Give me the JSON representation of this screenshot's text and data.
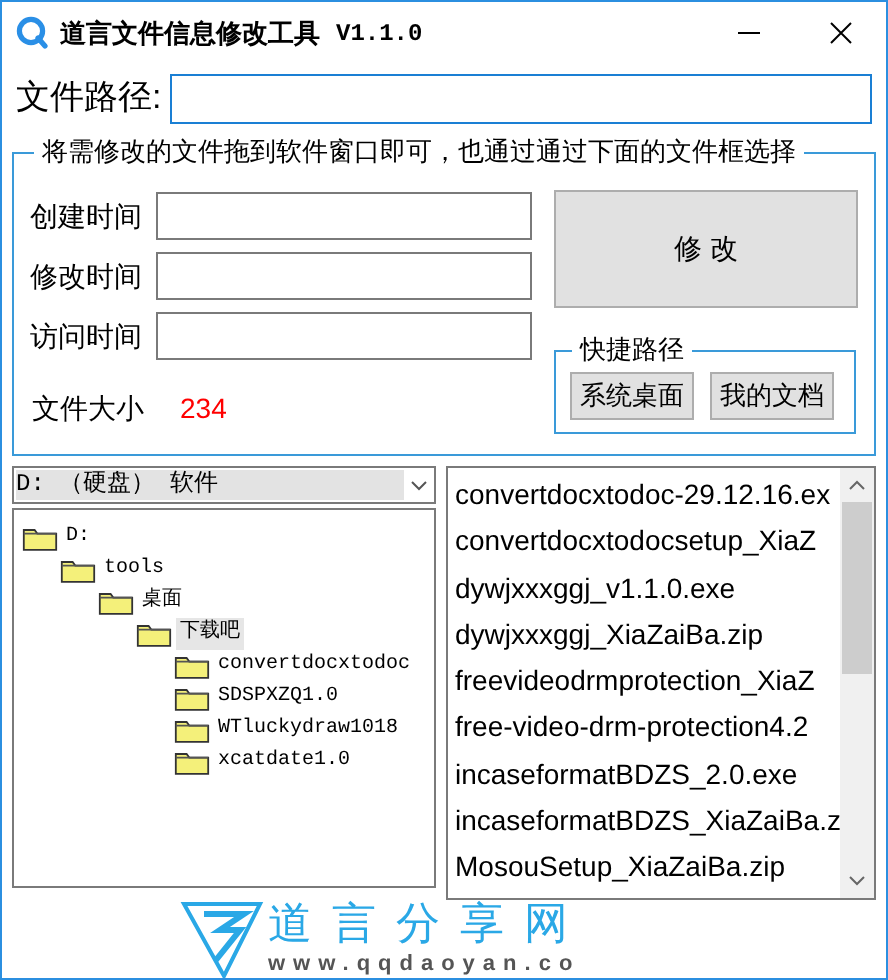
{
  "window": {
    "title": "道言文件信息修改工具",
    "version": "V1.1.0"
  },
  "path_field": {
    "label": "文件路径:"
  },
  "group": {
    "legend": "将需修改的文件拖到软件窗口即可，也通过通过下面的文件框选择",
    "fields": [
      {
        "label": "创建时间"
      },
      {
        "label": "修改时间"
      },
      {
        "label": "访问时间"
      }
    ],
    "size_label": "文件大小",
    "size_value": "234",
    "modify_button": "修 改",
    "shortcuts": {
      "legend": "快捷路径",
      "buttons": [
        "系统桌面",
        "我的文档"
      ]
    }
  },
  "drive_select": {
    "value": "D: （硬盘） 软件"
  },
  "tree": [
    {
      "label": "D:",
      "selected": false,
      "children": [
        {
          "label": "tools",
          "selected": false,
          "children": [
            {
              "label": "桌面",
              "selected": false,
              "children": [
                {
                  "label": "下载吧",
                  "selected": true,
                  "children": [
                    {
                      "label": "convertdocxtodoc",
                      "selected": false
                    },
                    {
                      "label": "SDSPXZQ1.0",
                      "selected": false
                    },
                    {
                      "label": "WTluckydraw1018",
                      "selected": false
                    },
                    {
                      "label": "xcatdate1.0",
                      "selected": false
                    }
                  ]
                }
              ]
            }
          ]
        }
      ]
    }
  ],
  "files": [
    {
      "name": "convertdocxtodoc-29.12.16.ex",
      "selected": false
    },
    {
      "name": "convertdocxtodocsetup_XiaZ",
      "selected": false
    },
    {
      "name": "dywjxxxggj_v1.1.0.exe",
      "selected": false
    },
    {
      "name": "dywjxxxggj_XiaZaiBa.zip",
      "selected": false
    },
    {
      "name": "freevideodrmprotection_XiaZ",
      "selected": false
    },
    {
      "name": "free-video-drm-protection4.2",
      "selected": false
    },
    {
      "name": "incaseformatBDZS_2.0.exe",
      "selected": false
    },
    {
      "name": "incaseformatBDZS_XiaZaiBa.z",
      "selected": false
    },
    {
      "name": "MosouSetup_XiaZaiBa.zip",
      "selected": false
    }
  ],
  "footer": {
    "brand": "道言分享网",
    "url": "www.qqdaoyan.co"
  }
}
